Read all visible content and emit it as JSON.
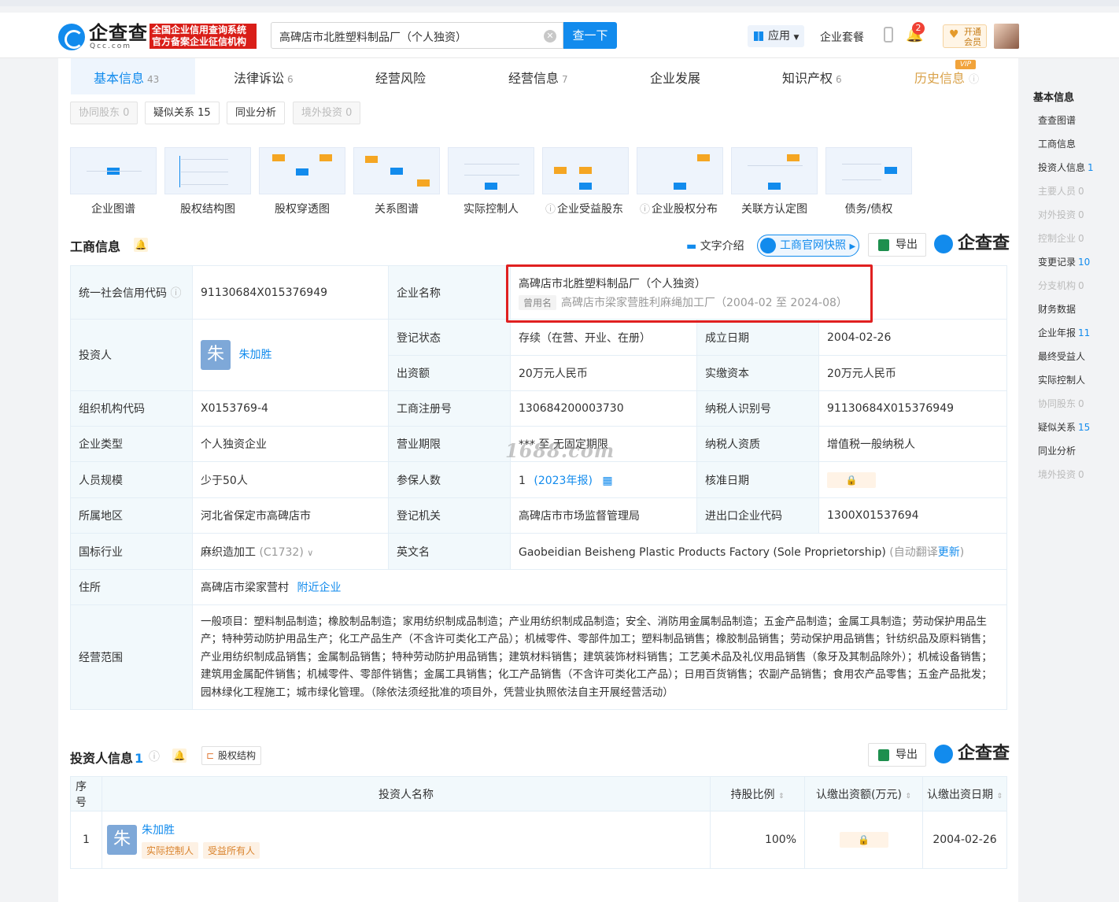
{
  "header": {
    "logo_text": "企查查",
    "logo_sub": "Qcc.com",
    "badge_line1": "全国企业信用查询系统",
    "badge_line2": "官方备案企业征信机构",
    "search_value": "高碑店市北胜塑料制品厂（个人独资）",
    "search_button": "查一下",
    "apps_label": "应用",
    "package_label": "企业套餐",
    "notification_count": "2",
    "vip_line1": "开通",
    "vip_line2": "会员"
  },
  "tabs": [
    {
      "label": "基本信息",
      "count": "43"
    },
    {
      "label": "法律诉讼",
      "count": "6"
    },
    {
      "label": "经营风险",
      "count": ""
    },
    {
      "label": "经营信息",
      "count": "7"
    },
    {
      "label": "企业发展",
      "count": ""
    },
    {
      "label": "知识产权",
      "count": "6"
    },
    {
      "label": "历史信息",
      "count": ""
    }
  ],
  "vip_tag": "VIP",
  "chips": [
    {
      "label": "协同股东 0"
    },
    {
      "label": "疑似关系 15"
    },
    {
      "label": "同业分析"
    },
    {
      "label": "境外投资 0"
    }
  ],
  "graphs": [
    "企业图谱",
    "股权结构图",
    "股权穿透图",
    "关系图谱",
    "实际控制人",
    "企业受益股东",
    "企业股权分布",
    "关联方认定图",
    "债务/债权"
  ],
  "biz_section": {
    "title": "工商信息",
    "text_intro": "文字介绍",
    "snapshot": "工商官网快照",
    "export": "导出",
    "brand": "企查查"
  },
  "info": {
    "credit_code_label": "统一社会信用代码",
    "credit_code": "91130684X015376949",
    "company_name_label": "企业名称",
    "company_name": "高碑店市北胜塑料制品厂（个人独资）",
    "former_tag": "曾用名",
    "former_name": "高碑店市梁家营胜利麻绳加工厂（2004-02 至 2024-08）",
    "investor_label": "投资人",
    "investor_avatar": "朱",
    "investor_name": "朱加胜",
    "status_label": "登记状态",
    "status": "存续（在营、开业、在册）",
    "found_label": "成立日期",
    "found": "2004-02-26",
    "capital_label": "出资额",
    "capital": "20万元人民币",
    "paid_label": "实缴资本",
    "paid": "20万元人民币",
    "org_code_label": "组织机构代码",
    "org_code": "X0153769-4",
    "reg_no_label": "工商注册号",
    "reg_no": "130684200003730",
    "taxpayer_id_label": "纳税人识别号",
    "taxpayer_id": "91130684X015376949",
    "type_label": "企业类型",
    "type": "个人独资企业",
    "term_label": "营业期限",
    "term": "*** 至 无固定期限",
    "tax_qual_label": "纳税人资质",
    "tax_qual": "增值税一般纳税人",
    "staff_label": "人员规模",
    "staff": "少于50人",
    "insured_label": "参保人数",
    "insured": "1",
    "insured_year": "(2023年报)",
    "approve_label": "核准日期",
    "region_label": "所属地区",
    "region": "河北省保定市高碑店市",
    "authority_label": "登记机关",
    "authority": "高碑店市市场监督管理局",
    "ie_label": "进出口企业代码",
    "ie_code": "1300X01537694",
    "industry_label": "国标行业",
    "industry": "麻织造加工",
    "industry_code": "(C1732)",
    "en_label": "英文名",
    "en_name": "Gaobeidian Beisheng Plastic Products Factory (Sole Proprietorship)",
    "en_auto": "(自动翻译",
    "en_update": "更新",
    "en_close": ")",
    "address_label": "住所",
    "address": "高碑店市梁家营村",
    "nearby": "附近企业",
    "scope_label": "经营范围",
    "scope": "一般项目：塑料制品制造；橡胶制品制造；家用纺织制成品制造；产业用纺织制成品制造；安全、消防用金属制品制造；五金产品制造；金属工具制造；劳动保护用品生产；特种劳动防护用品生产；化工产品生产（不含许可类化工产品）；机械零件、零部件加工；塑料制品销售；橡胶制品销售；劳动保护用品销售；针纺织品及原料销售；产业用纺织制成品销售；金属制品销售；特种劳动防护用品销售；建筑材料销售；建筑装饰材料销售；工艺美术品及礼仪用品销售（象牙及其制品除外）；机械设备销售；建筑用金属配件销售；机械零件、零部件销售；金属工具销售；化工产品销售（不含许可类化工产品）；日用百货销售；农副产品销售；食用农产品零售；五金产品批发；园林绿化工程施工；城市绿化管理。（除依法须经批准的项目外，凭营业执照依法自主开展经营活动）"
  },
  "watermark": "1688.com",
  "investor_section": {
    "title": "投资人信息",
    "count": "1",
    "equity_btn": "股权结构",
    "export": "导出",
    "brand": "企查查",
    "headers": [
      "序号",
      "投资人名称",
      "持股比例",
      "认缴出资额(万元)",
      "认缴出资日期"
    ],
    "rows": [
      {
        "no": "1",
        "avatar": "朱",
        "name": "朱加胜",
        "tag1": "实际控制人",
        "tag2": "受益所有人",
        "ratio": "100%",
        "date": "2004-02-26"
      }
    ]
  },
  "sidebar": {
    "head": "基本信息",
    "items": [
      {
        "label": "查查图谱",
        "n": "",
        "dis": false
      },
      {
        "label": "工商信息",
        "n": "",
        "dis": false
      },
      {
        "label": "投资人信息",
        "n": "1",
        "dis": false
      },
      {
        "label": "主要人员",
        "n": "0",
        "dis": true
      },
      {
        "label": "对外投资",
        "n": "0",
        "dis": true
      },
      {
        "label": "控制企业",
        "n": "0",
        "dis": true
      },
      {
        "label": "变更记录",
        "n": "10",
        "dis": false
      },
      {
        "label": "分支机构",
        "n": "0",
        "dis": true
      },
      {
        "label": "财务数据",
        "n": "",
        "dis": false
      },
      {
        "label": "企业年报",
        "n": "11",
        "dis": false
      },
      {
        "label": "最终受益人",
        "n": "",
        "dis": false
      },
      {
        "label": "实际控制人",
        "n": "",
        "dis": false
      },
      {
        "label": "协同股东",
        "n": "0",
        "dis": true
      },
      {
        "label": "疑似关系",
        "n": "15",
        "dis": false
      },
      {
        "label": "同业分析",
        "n": "",
        "dis": false
      },
      {
        "label": "境外投资",
        "n": "0",
        "dis": true
      }
    ]
  }
}
